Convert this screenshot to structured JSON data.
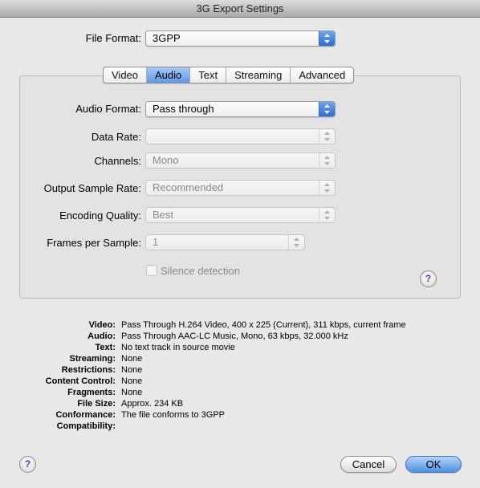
{
  "window": {
    "title": "3G Export Settings"
  },
  "file_format": {
    "label": "File Format:",
    "value": "3GPP"
  },
  "tabs": [
    "Video",
    "Audio",
    "Text",
    "Streaming",
    "Advanced"
  ],
  "selected_tab": "Audio",
  "audio": {
    "audio_format": {
      "label": "Audio Format:",
      "value": "Pass through"
    },
    "data_rate": {
      "label": "Data Rate:",
      "value": ""
    },
    "channels": {
      "label": "Channels:",
      "value": "Mono"
    },
    "output_sample_rate": {
      "label": "Output Sample Rate:",
      "value": "Recommended"
    },
    "encoding_quality": {
      "label": "Encoding Quality:",
      "value": "Best"
    },
    "frames_per_sample": {
      "label": "Frames per Sample:",
      "value": "1"
    },
    "silence_detection": {
      "label": "Silence detection",
      "checked": false
    }
  },
  "summary": [
    {
      "key": "Video:",
      "value": "Pass Through H.264 Video, 400 x 225 (Current), 311 kbps, current frame"
    },
    {
      "key": "Audio:",
      "value": "Pass Through AAC-LC Music, Mono, 63 kbps, 32.000 kHz"
    },
    {
      "key": "Text:",
      "value": "No text track in source movie"
    },
    {
      "key": "Streaming:",
      "value": "None"
    },
    {
      "key": "Restrictions:",
      "value": "None"
    },
    {
      "key": "Content Control:",
      "value": "None"
    },
    {
      "key": "Fragments:",
      "value": "None"
    },
    {
      "key": "File Size:",
      "value": "Approx. 234 KB"
    },
    {
      "key": "Conformance:",
      "value": "The file conforms to 3GPP"
    },
    {
      "key": "Compatibility:",
      "value": ""
    }
  ],
  "buttons": {
    "help": "?",
    "cancel": "Cancel",
    "ok": "OK"
  },
  "colors": {
    "accent": "#4d8fe3",
    "help_glyph": "#5b2fa3"
  }
}
